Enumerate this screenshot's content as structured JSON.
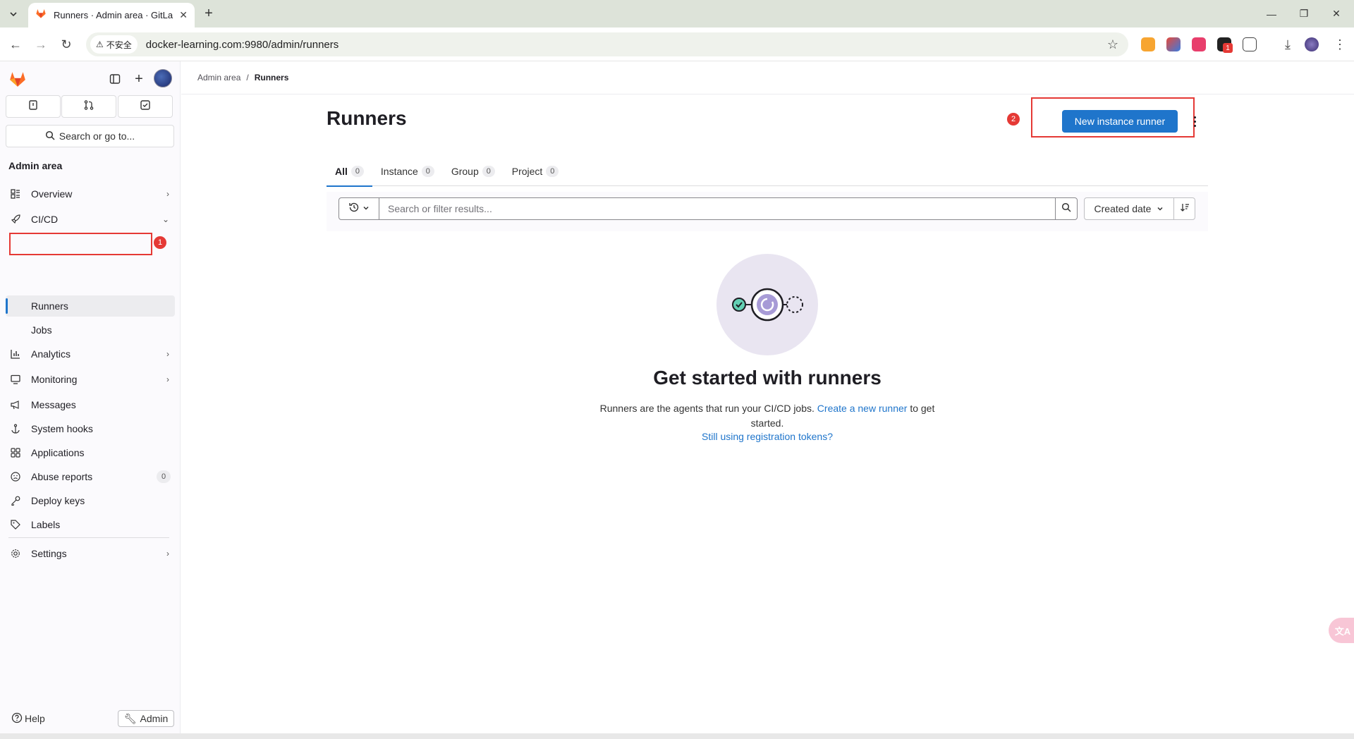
{
  "browser": {
    "tab_title": "Runners · Admin area · GitLab",
    "address": "docker-learning.com:9980/admin/runners",
    "insecure_label": "不安全",
    "extension_badge": "1"
  },
  "sidebar": {
    "search_placeholder": "Search or go to...",
    "heading": "Admin area",
    "items": {
      "overview": "Overview",
      "cicd": "CI/CD",
      "runners": "Runners",
      "jobs": "Jobs",
      "analytics": "Analytics",
      "monitoring": "Monitoring",
      "messages": "Messages",
      "system_hooks": "System hooks",
      "applications": "Applications",
      "abuse_reports": "Abuse reports",
      "abuse_reports_count": "0",
      "deploy_keys": "Deploy keys",
      "labels": "Labels",
      "settings": "Settings"
    },
    "help": "Help",
    "admin": "Admin"
  },
  "annotations": {
    "first": "1",
    "second": "2"
  },
  "breadcrumb": {
    "parent": "Admin area",
    "separator": "/",
    "current": "Runners"
  },
  "page": {
    "title": "Runners",
    "new_runner_button": "New instance runner",
    "tabs": [
      {
        "label": "All",
        "count": "0"
      },
      {
        "label": "Instance",
        "count": "0"
      },
      {
        "label": "Group",
        "count": "0"
      },
      {
        "label": "Project",
        "count": "0"
      }
    ],
    "filter_placeholder": "Search or filter results...",
    "sort_label": "Created date",
    "empty_title": "Get started with runners",
    "empty_desc_prefix": "Runners are the agents that run your CI/CD jobs. ",
    "empty_desc_link": "Create a new runner",
    "empty_desc_suffix": " to get started.",
    "empty_link2": "Still using registration tokens?"
  },
  "colors": {
    "accent": "#1f75cb",
    "annotation": "#e53935",
    "sidebar_bg": "#fbfafd"
  }
}
